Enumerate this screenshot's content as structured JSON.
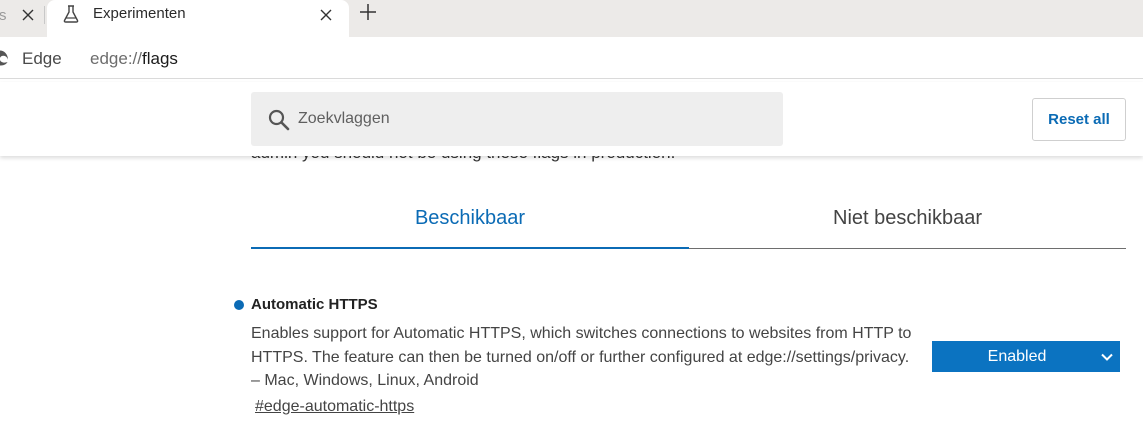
{
  "browser": {
    "prev_tab": {
      "title_fragment": "s"
    },
    "active_tab": {
      "title": "Experimenten",
      "icon": "flask-icon"
    },
    "new_tab_icon": "plus-icon",
    "address": {
      "site_label": "Edge",
      "url_scheme": "edge://",
      "url_path": "flags"
    }
  },
  "header": {
    "search_placeholder": "Zoekvlaggen",
    "reset_label": "Reset all"
  },
  "warning_fragment": "admin you should not be using these flags in production.",
  "tabs": {
    "available": "Beschikbaar",
    "unavailable": "Niet beschikbaar",
    "selected": "available"
  },
  "flag": {
    "title": "Automatic HTTPS",
    "description": "Enables support for Automatic HTTPS, which switches connections to websites from HTTP to HTTPS. The feature can then be turned on/off or further configured at edge://settings/privacy. – Mac, Windows, Linux, Android",
    "link": "#edge-automatic-https",
    "state": "Enabled"
  },
  "colors": {
    "accent": "#0b6bb5",
    "select_bg": "#0b73c1",
    "tabstrip_bg": "#eceae8",
    "search_bg": "#eeeeee"
  }
}
